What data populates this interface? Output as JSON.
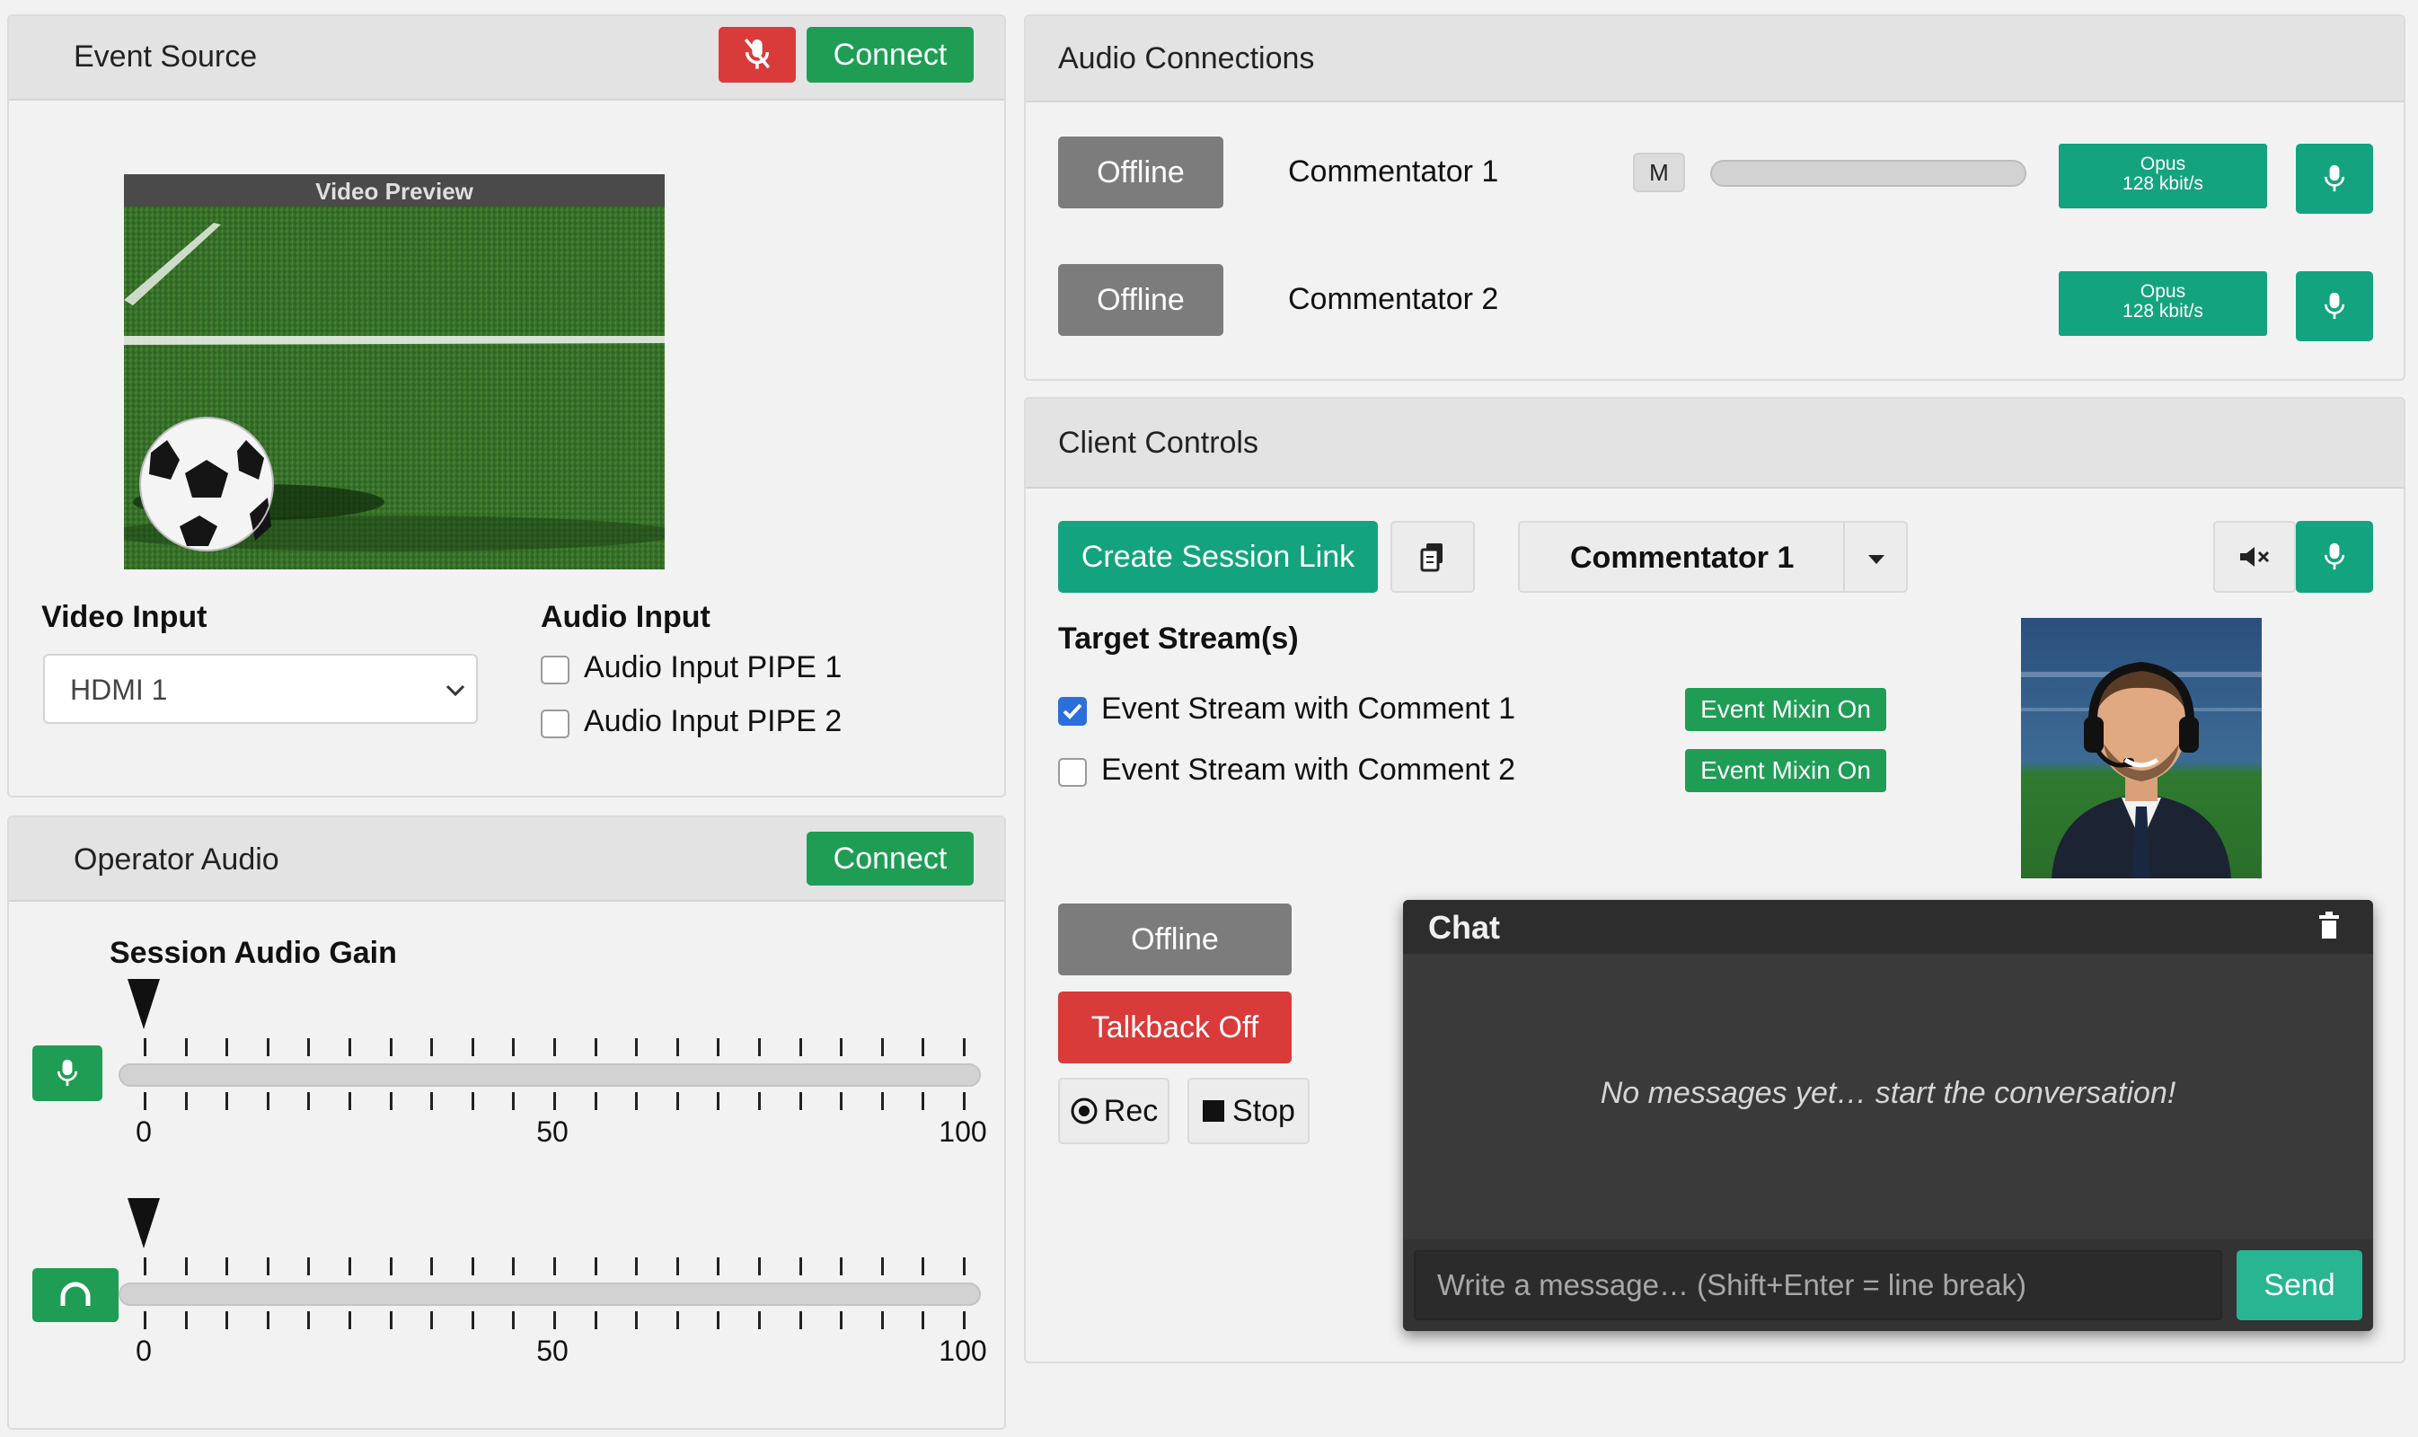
{
  "event_source": {
    "title": "Event Source",
    "connect_label": "Connect",
    "mute_icon": "mic-off-icon",
    "video_preview_label": "Video Preview",
    "video_input_label": "Video Input",
    "video_input_value": "HDMI 1",
    "audio_input_label": "Audio Input",
    "audio_inputs": [
      {
        "label": "Audio Input PIPE 1",
        "checked": false
      },
      {
        "label": "Audio Input PIPE 2",
        "checked": false
      }
    ]
  },
  "operator_audio": {
    "title": "Operator Audio",
    "connect_label": "Connect",
    "gain_label": "Session Audio Gain",
    "sliders": [
      {
        "icon": "mic-icon",
        "value": 0,
        "tick_labels": [
          "0",
          "50",
          "100"
        ]
      },
      {
        "icon": "headphones-icon",
        "value": 0,
        "tick_labels": [
          "0",
          "50",
          "100"
        ]
      }
    ]
  },
  "audio_connections": {
    "title": "Audio Connections",
    "rows": [
      {
        "status": "Offline",
        "name": "Commentator 1",
        "mute_label": "M",
        "codec_line1": "Opus",
        "codec_line2": "128 kbit/s"
      },
      {
        "status": "Offline",
        "name": "Commentator 2",
        "codec_line1": "Opus",
        "codec_line2": "128 kbit/s"
      }
    ]
  },
  "client_controls": {
    "title": "Client Controls",
    "create_session_label": "Create Session Link",
    "selected_commentator": "Commentator 1",
    "target_streams_label": "Target Stream(s)",
    "streams": [
      {
        "label": "Event Stream with Comment 1",
        "checked": true,
        "badge": "Event Mixin On"
      },
      {
        "label": "Event Stream with Comment 2",
        "checked": false,
        "badge": "Event Mixin On"
      }
    ],
    "status_label": "Offline",
    "talkback_label": "Talkback Off",
    "rec_label": "Rec",
    "stop_label": "Stop"
  },
  "chat": {
    "title": "Chat",
    "empty_message": "No messages yet… start the conversation!",
    "input_placeholder": "Write a message… (Shift+Enter = line break)",
    "send_label": "Send"
  },
  "colors": {
    "green": "#1f9d55",
    "red": "#d93a3a",
    "chat_bg": "#3a3a3a",
    "checkbox_blue": "#2a6fdc"
  }
}
